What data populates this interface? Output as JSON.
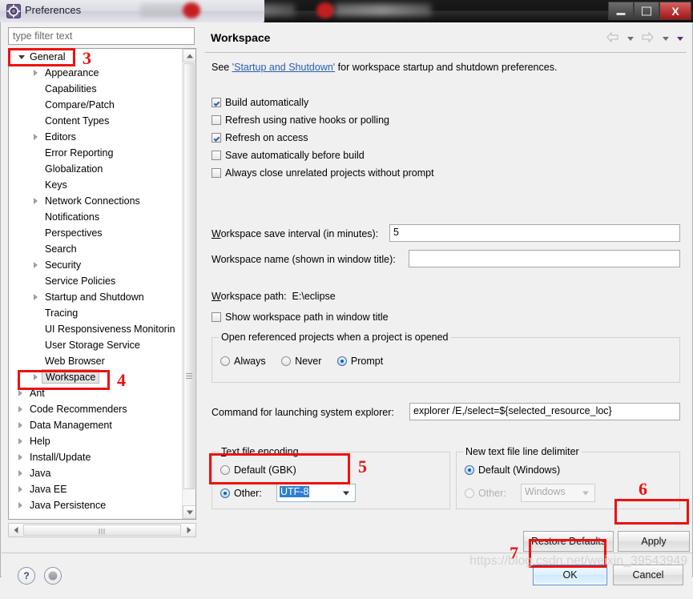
{
  "window": {
    "title": "Preferences",
    "icon": "eclipse-gear-icon",
    "minimize_label": "Minimize",
    "maximize_label": "Maximize",
    "close_label": "X"
  },
  "filter": {
    "placeholder": "type filter text",
    "value": ""
  },
  "tree": {
    "items": [
      {
        "label": "General",
        "indent": 0,
        "twisty": "open",
        "selected": false
      },
      {
        "label": "Appearance",
        "indent": 1,
        "twisty": "closed",
        "selected": false
      },
      {
        "label": "Capabilities",
        "indent": 1,
        "twisty": "none",
        "selected": false
      },
      {
        "label": "Compare/Patch",
        "indent": 1,
        "twisty": "none",
        "selected": false
      },
      {
        "label": "Content Types",
        "indent": 1,
        "twisty": "none",
        "selected": false
      },
      {
        "label": "Editors",
        "indent": 1,
        "twisty": "closed",
        "selected": false
      },
      {
        "label": "Error Reporting",
        "indent": 1,
        "twisty": "none",
        "selected": false
      },
      {
        "label": "Globalization",
        "indent": 1,
        "twisty": "none",
        "selected": false
      },
      {
        "label": "Keys",
        "indent": 1,
        "twisty": "none",
        "selected": false
      },
      {
        "label": "Network Connections",
        "indent": 1,
        "twisty": "closed",
        "selected": false
      },
      {
        "label": "Notifications",
        "indent": 1,
        "twisty": "none",
        "selected": false
      },
      {
        "label": "Perspectives",
        "indent": 1,
        "twisty": "none",
        "selected": false
      },
      {
        "label": "Search",
        "indent": 1,
        "twisty": "none",
        "selected": false
      },
      {
        "label": "Security",
        "indent": 1,
        "twisty": "closed",
        "selected": false
      },
      {
        "label": "Service Policies",
        "indent": 1,
        "twisty": "none",
        "selected": false
      },
      {
        "label": "Startup and Shutdown",
        "indent": 1,
        "twisty": "closed",
        "selected": false
      },
      {
        "label": "Tracing",
        "indent": 1,
        "twisty": "none",
        "selected": false
      },
      {
        "label": "UI Responsiveness Monitorin",
        "indent": 1,
        "twisty": "none",
        "selected": false
      },
      {
        "label": "User Storage Service",
        "indent": 1,
        "twisty": "none",
        "selected": false
      },
      {
        "label": "Web Browser",
        "indent": 1,
        "twisty": "none",
        "selected": false
      },
      {
        "label": "Workspace",
        "indent": 1,
        "twisty": "closed",
        "selected": true
      },
      {
        "label": "Ant",
        "indent": 0,
        "twisty": "closed",
        "selected": false
      },
      {
        "label": "Code Recommenders",
        "indent": 0,
        "twisty": "closed",
        "selected": false
      },
      {
        "label": "Data Management",
        "indent": 0,
        "twisty": "closed",
        "selected": false
      },
      {
        "label": "Help",
        "indent": 0,
        "twisty": "closed",
        "selected": false
      },
      {
        "label": "Install/Update",
        "indent": 0,
        "twisty": "closed",
        "selected": false
      },
      {
        "label": "Java",
        "indent": 0,
        "twisty": "closed",
        "selected": false
      },
      {
        "label": "Java EE",
        "indent": 0,
        "twisty": "closed",
        "selected": false
      },
      {
        "label": "Java Persistence",
        "indent": 0,
        "twisty": "closed",
        "selected": false
      }
    ]
  },
  "page": {
    "title": "Workspace",
    "description_prefix": "See ",
    "description_link": "'Startup and Shutdown'",
    "description_suffix": " for workspace startup and shutdown preferences.",
    "checkboxes": [
      {
        "label": "Build automatically",
        "checked": true
      },
      {
        "label": "Refresh using native hooks or polling",
        "checked": false
      },
      {
        "label": "Refresh on access",
        "checked": true
      },
      {
        "label": "Save automatically before build",
        "checked": false
      },
      {
        "label": "Always close unrelated projects without prompt",
        "checked": false
      }
    ],
    "save_interval_label": "Workspace save interval (in minutes):",
    "save_interval_value": "5",
    "workspace_name_label": "Workspace name (shown in window title):",
    "workspace_name_value": "",
    "workspace_path_label": "Workspace path:",
    "workspace_path_value": "E:\\eclipse",
    "show_path_checkbox": {
      "label": "Show workspace path in window title",
      "checked": false
    },
    "open_referenced_group": {
      "title": "Open referenced projects when a project is opened",
      "options": [
        {
          "label": "Always",
          "selected": false
        },
        {
          "label": "Never",
          "selected": false
        },
        {
          "label": "Prompt",
          "selected": true
        }
      ]
    },
    "explorer_command_label": "Command for launching system explorer:",
    "explorer_command_value": "explorer /E,/select=${selected_resource_loc}",
    "encoding_group": {
      "title": "Text file encoding",
      "default_label": "Default (GBK)",
      "default_selected": false,
      "other_label": "Other:",
      "other_selected": true,
      "other_value": "UTF-8"
    },
    "delimiter_group": {
      "title": "New text file line delimiter",
      "default_label": "Default (Windows)",
      "default_selected": true,
      "other_label": "Other:",
      "other_selected": false,
      "other_value": "Windows"
    }
  },
  "buttons": {
    "restore_defaults": "Restore Defaults",
    "apply": "Apply",
    "ok": "OK",
    "cancel": "Cancel"
  },
  "bottom_icons": {
    "help": "?",
    "shell": "shell-icon"
  },
  "annotations": [
    {
      "number": "3"
    },
    {
      "number": "4"
    },
    {
      "number": "5"
    },
    {
      "number": "6"
    },
    {
      "number": "7"
    }
  ],
  "watermark": "https://blog.csdn.net/weixin_39543949",
  "colors": {
    "annotation_red": "#ee1111",
    "link_blue": "#2a5db0",
    "selection_blue": "#2f7fd0",
    "dialog_bg": "#f0f0f0"
  }
}
